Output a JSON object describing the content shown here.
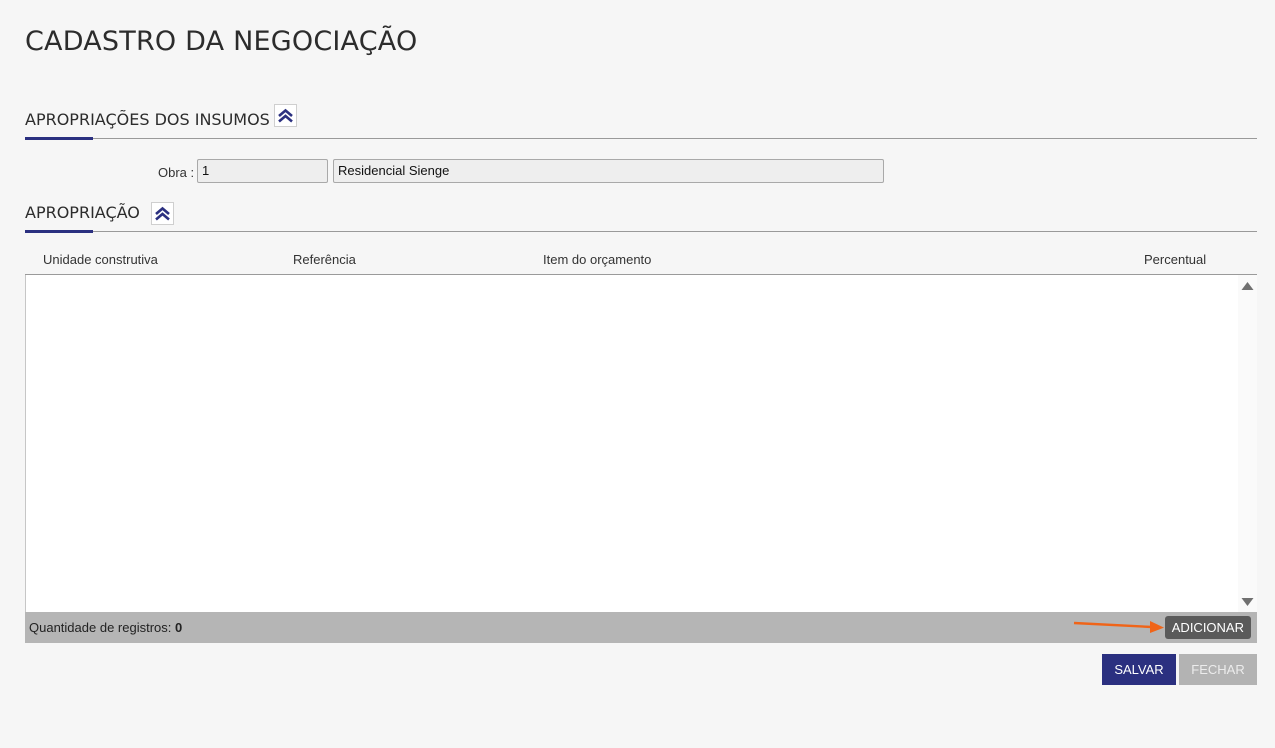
{
  "page": {
    "title": "CADASTRO DA NEGOCIAÇÃO"
  },
  "sections": {
    "insumos": {
      "title": "APROPRIAÇÕES DOS INSUMOS",
      "icon": "double-chevron-up-icon"
    },
    "apropriacao": {
      "title": "APROPRIAÇÃO",
      "icon": "double-chevron-up-icon"
    }
  },
  "obra": {
    "label": "Obra :",
    "code_value": "1",
    "name_value": "Residencial Sienge"
  },
  "table": {
    "columns": [
      "Unidade construtiva",
      "Referência",
      "Item do orçamento",
      "Percentual"
    ],
    "rows": []
  },
  "footer": {
    "record_count_label": "Quantidade de registros:",
    "record_count_value": "0",
    "add_label": "ADICIONAR"
  },
  "actions": {
    "save_label": "SALVAR",
    "close_label": "FECHAR"
  },
  "colors": {
    "primary": "#2b3080",
    "annotation_arrow": "#f06418",
    "add_button": "#5a5a5a",
    "disabled_button": "#b3b3b3"
  }
}
